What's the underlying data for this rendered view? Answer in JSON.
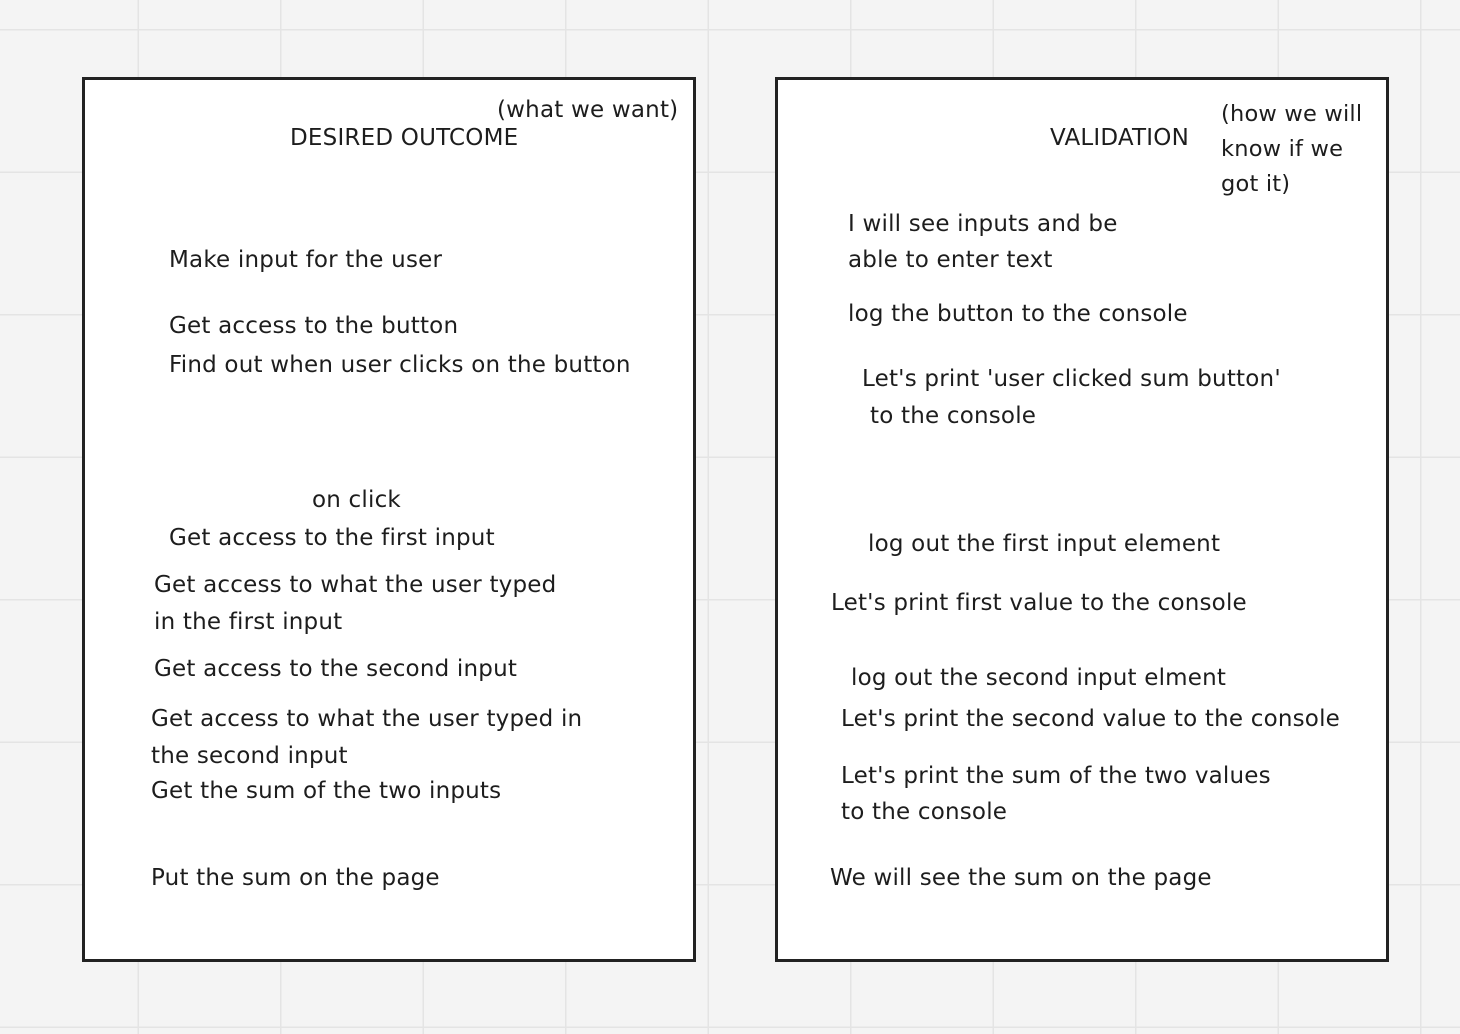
{
  "desired_outcome": {
    "title": "DESIRED OUTCOME",
    "note": "(what we want)",
    "items": [
      "Make input for the user",
      "Get access to the button",
      "Find out when user clicks on the button",
      "on click",
      "Get access to the first input",
      "Get access to what the user typed",
      "in the first input",
      "Get access to the second input",
      "Get access to what the user typed in",
      "the second input",
      "Get the sum of the two inputs",
      "Put the sum on the page"
    ]
  },
  "validation": {
    "title": "VALIDATION",
    "note_lines": [
      "(how we will",
      "know if we",
      "got it)"
    ],
    "items": [
      "I will see inputs and be",
      "able to enter text",
      "log the button to the console",
      "Let's print 'user clicked sum button'",
      "to the console",
      "log out the first input element",
      "Let's print first value to the console",
      "log out the second input elment",
      "Let's print the second value to the console",
      "Let's print the sum of the two values",
      "to the console",
      "We will see the sum on the page"
    ]
  }
}
